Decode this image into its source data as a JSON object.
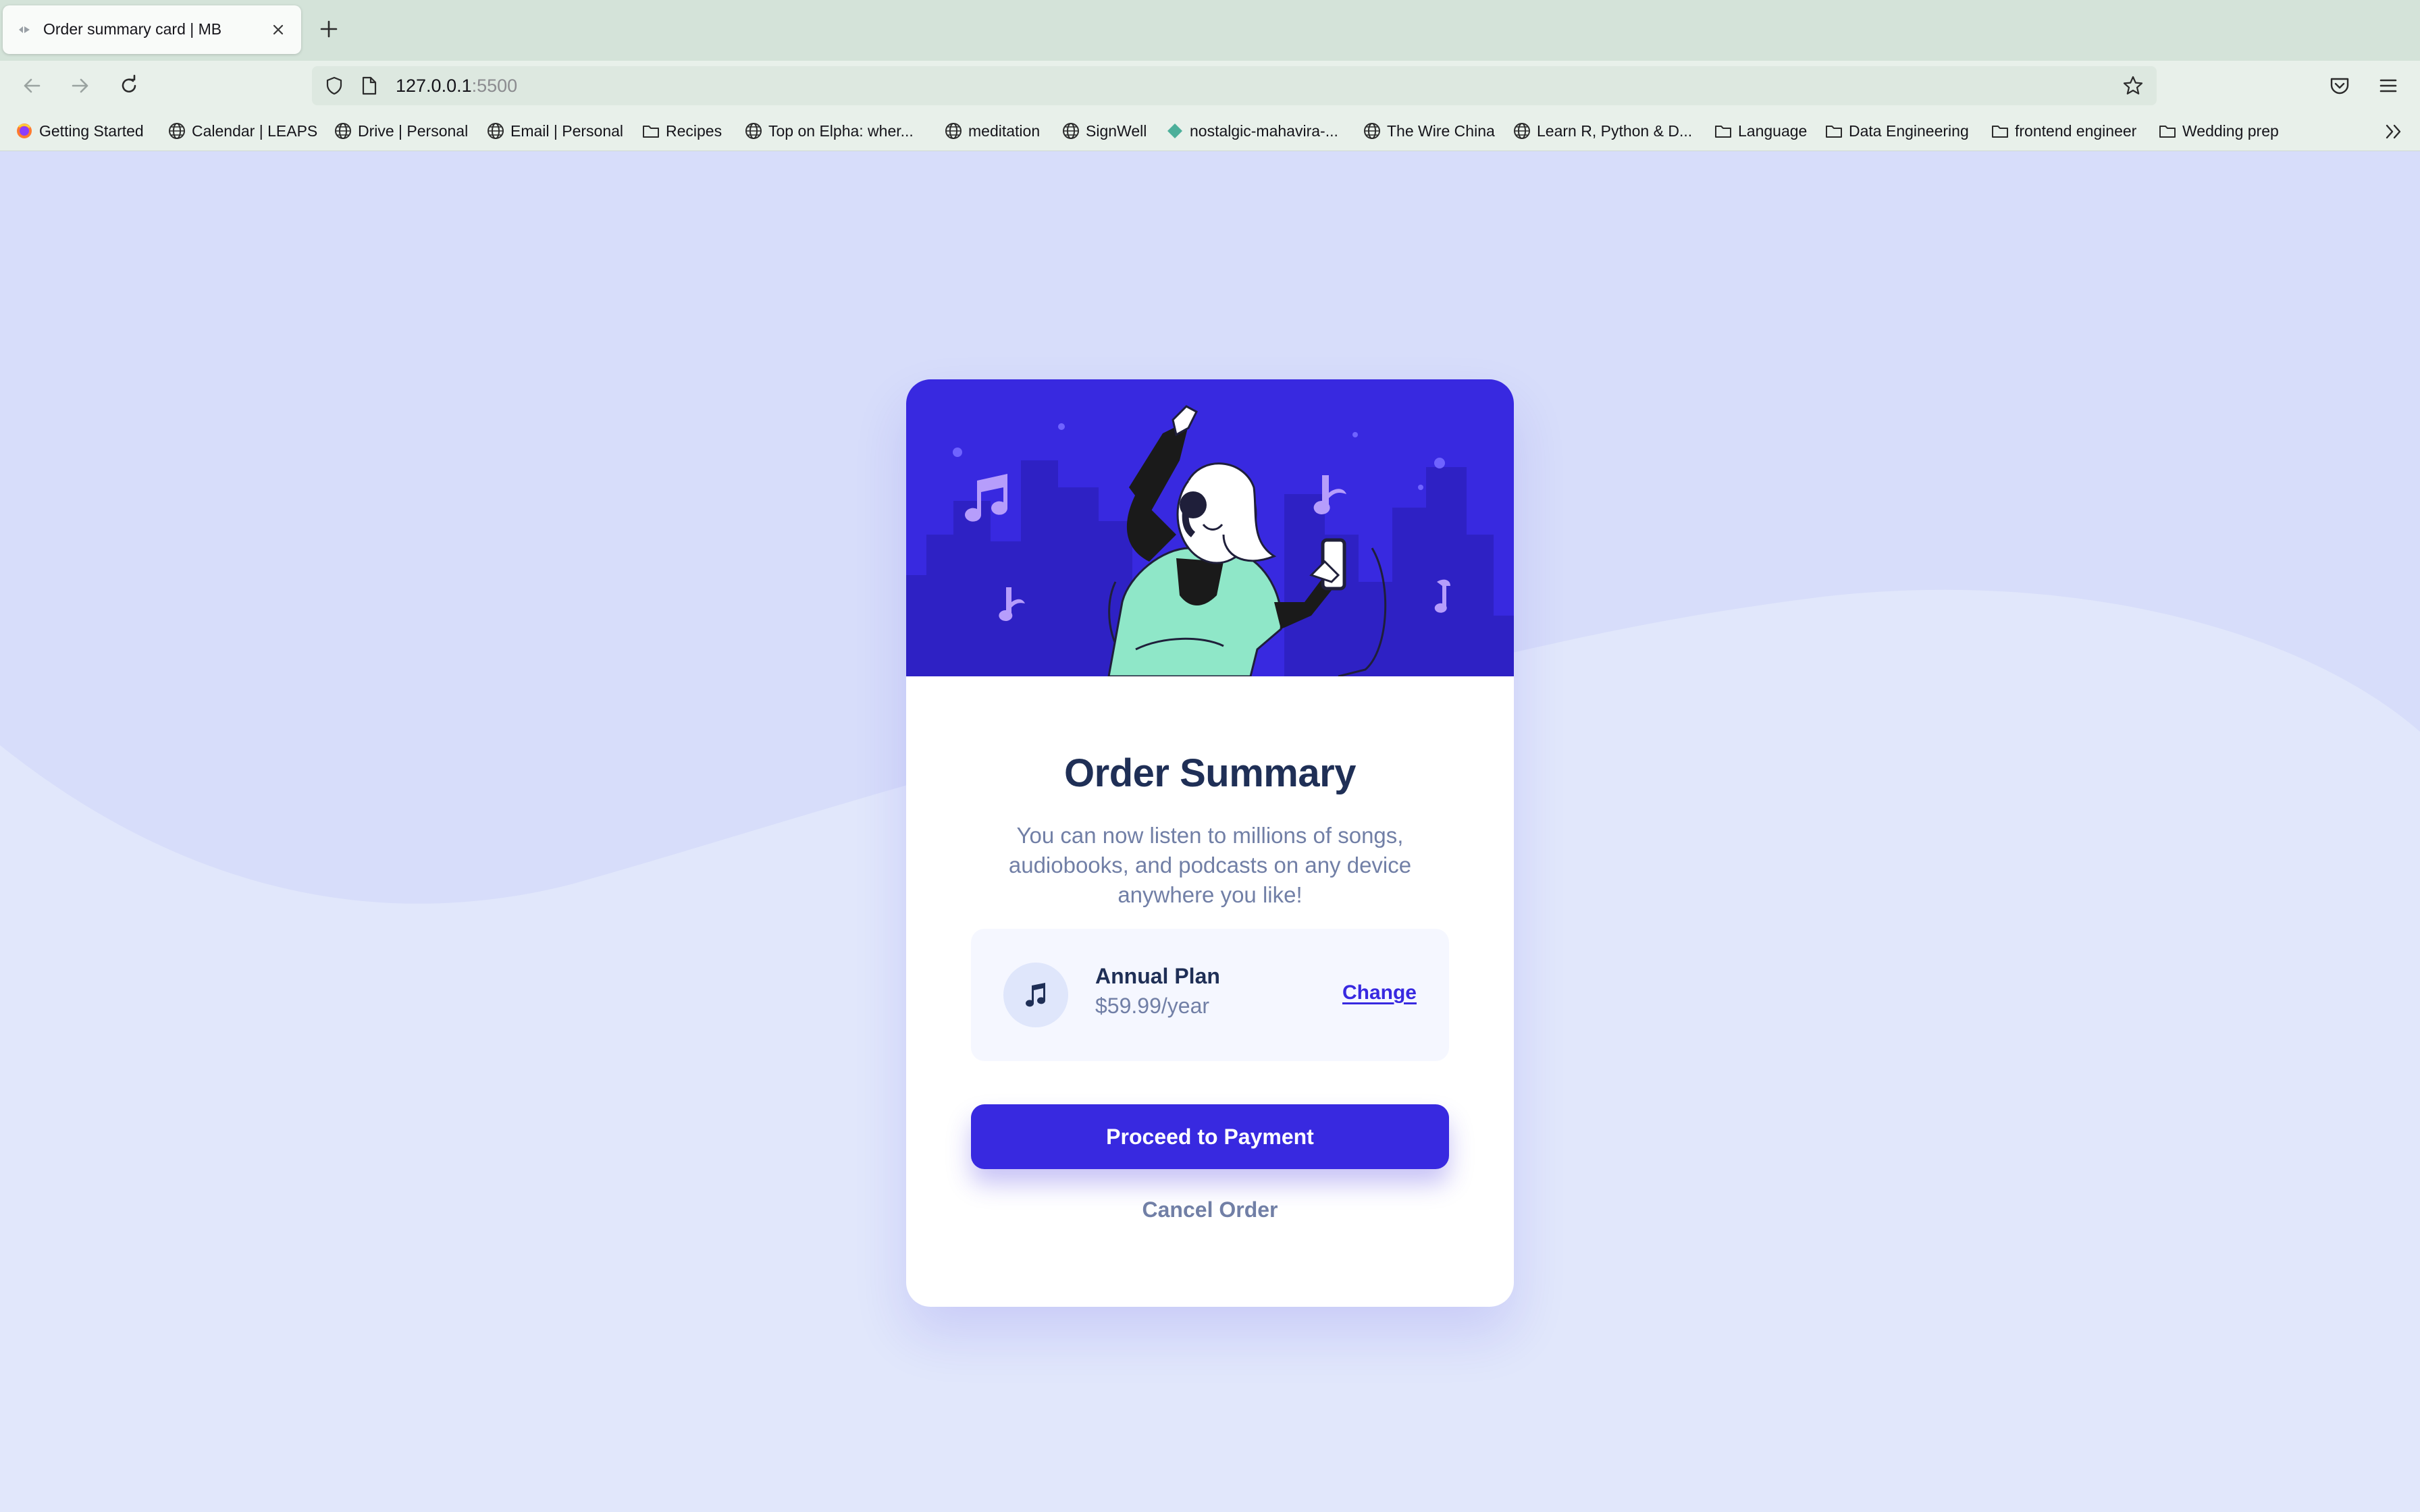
{
  "browser": {
    "tab_title": "Order summary card | MB",
    "url_host": "127.0.0.1",
    "url_port": ":5500"
  },
  "bookmarks": [
    {
      "label": "Getting Started",
      "icon": "firefox-icon"
    },
    {
      "label": "Calendar | LEAPS",
      "icon": "globe-icon"
    },
    {
      "label": "Drive | Personal",
      "icon": "globe-icon"
    },
    {
      "label": "Email | Personal",
      "icon": "globe-icon"
    },
    {
      "label": "Recipes",
      "icon": "folder-icon"
    },
    {
      "label": "Top on Elpha: wher...",
      "icon": "globe-icon"
    },
    {
      "label": "meditation",
      "icon": "globe-icon"
    },
    {
      "label": "SignWell",
      "icon": "globe-icon"
    },
    {
      "label": "nostalgic-mahavira-...",
      "icon": "diamond-icon"
    },
    {
      "label": "The Wire China",
      "icon": "globe-icon"
    },
    {
      "label": "Learn R, Python & D...",
      "icon": "globe-icon"
    },
    {
      "label": "Language",
      "icon": "folder-icon"
    },
    {
      "label": "Data Engineering",
      "icon": "folder-icon"
    },
    {
      "label": "frontend engineer",
      "icon": "folder-icon"
    },
    {
      "label": "Wedding prep",
      "icon": "folder-icon"
    }
  ],
  "card": {
    "title": "Order Summary",
    "description": "You can now listen to millions of songs, audiobooks, and podcasts on any device anywhere you like!",
    "plan": {
      "name": "Annual Plan",
      "price": "$59.99/year",
      "change_label": "Change",
      "icon": "music-note-icon"
    },
    "pay_label": "Proceed to Payment",
    "cancel_label": "Cancel Order"
  },
  "colors": {
    "page_bg": "#e1e7fb",
    "accent": "#3829e0",
    "hero_bg": "#3829e0",
    "title": "#1f2f56",
    "muted": "#717fa6"
  }
}
